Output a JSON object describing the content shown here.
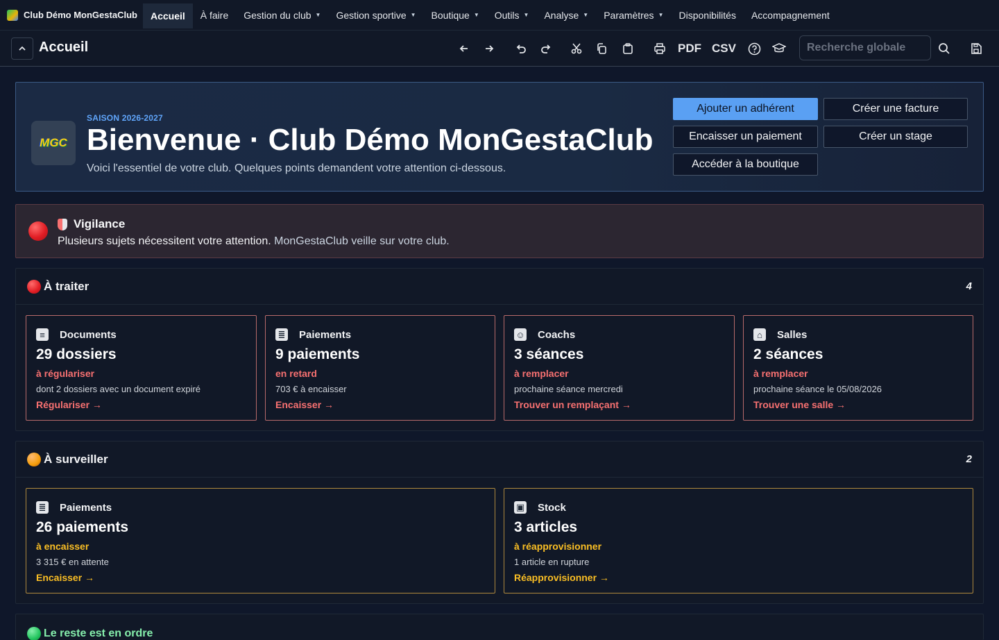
{
  "app": {
    "brand": "Club Démo MonGestaClub",
    "nav": [
      {
        "label": "Accueil",
        "active": true
      },
      {
        "label": "À faire"
      },
      {
        "label": "Gestion du club",
        "dropdown": true
      },
      {
        "label": "Gestion sportive",
        "dropdown": true
      },
      {
        "label": "Boutique",
        "dropdown": true
      },
      {
        "label": "Outils",
        "dropdown": true
      },
      {
        "label": "Analyse",
        "dropdown": true
      },
      {
        "label": "Paramètres",
        "dropdown": true
      },
      {
        "label": "Disponibilités"
      },
      {
        "label": "Accompagnement"
      }
    ]
  },
  "toolbar": {
    "page_title": "Accueil",
    "pdf_label": "PDF",
    "csv_label": "CSV",
    "search_placeholder": "Recherche globale",
    "icons": [
      "chevron-up-icon",
      "arrow-left-icon",
      "arrow-right-icon",
      "undo-icon",
      "redo-icon",
      "cut-icon",
      "copy-icon",
      "paste-icon",
      "print-icon",
      "help-icon",
      "graduation-cap-icon",
      "search-icon",
      "save-icon"
    ]
  },
  "hero": {
    "season": "SAISON 2026-2027",
    "title": "Bienvenue · Club Démo MonGestaClub",
    "subtitle": "Voici l'essentiel de votre club. Quelques points demandent votre attention ci-dessous.",
    "actions": {
      "add_member": "Ajouter un adhérent",
      "create_invoice": "Créer une facture",
      "collect_payment": "Encaisser un paiement",
      "create_course": "Créer un stage",
      "shop": "Accéder à la boutique"
    }
  },
  "vigilance": {
    "title": "Vigilance",
    "text": "Plusieurs sujets nécessitent votre attention.",
    "text_muted": "MonGestaClub veille sur votre club."
  },
  "sections": {
    "to_handle": {
      "title": "À traiter",
      "count": "4",
      "color": "#f87171",
      "cards": [
        {
          "icon": "document-icon",
          "title": "Documents",
          "value": "29 dossiers",
          "status": "à régulariser",
          "detail": "dont 2 dossiers avec un document expiré",
          "link": "Régulariser →"
        },
        {
          "icon": "clipboard-icon",
          "title": "Paiements",
          "value": "9 paiements",
          "status": "en retard",
          "detail": "703 € à encaisser",
          "link": "Encaisser →"
        },
        {
          "icon": "coach-icon",
          "title": "Coachs",
          "value": "3 séances",
          "status": "à remplacer",
          "detail": "prochaine séance mercredi",
          "link": "Trouver un remplaçant →"
        },
        {
          "icon": "building-icon",
          "title": "Salles",
          "value": "2 séances",
          "status": "à remplacer",
          "detail": "prochaine séance le 05/08/2026",
          "link": "Trouver une salle →"
        }
      ]
    },
    "to_watch": {
      "title": "À surveiller",
      "count": "2",
      "color": "#fbbf24",
      "cards": [
        {
          "icon": "clipboard-icon",
          "title": "Paiements",
          "value": "26 paiements",
          "status": "à encaisser",
          "detail": "3 315 € en attente",
          "link": "Encaisser →"
        },
        {
          "icon": "package-icon",
          "title": "Stock",
          "value": "3 articles",
          "status": "à réapprovisionner",
          "detail": "1 article en rupture",
          "link": "Réapprovisionner →"
        }
      ]
    },
    "all_good": {
      "title": "Le reste est en ordre",
      "color": "#86efac"
    }
  }
}
